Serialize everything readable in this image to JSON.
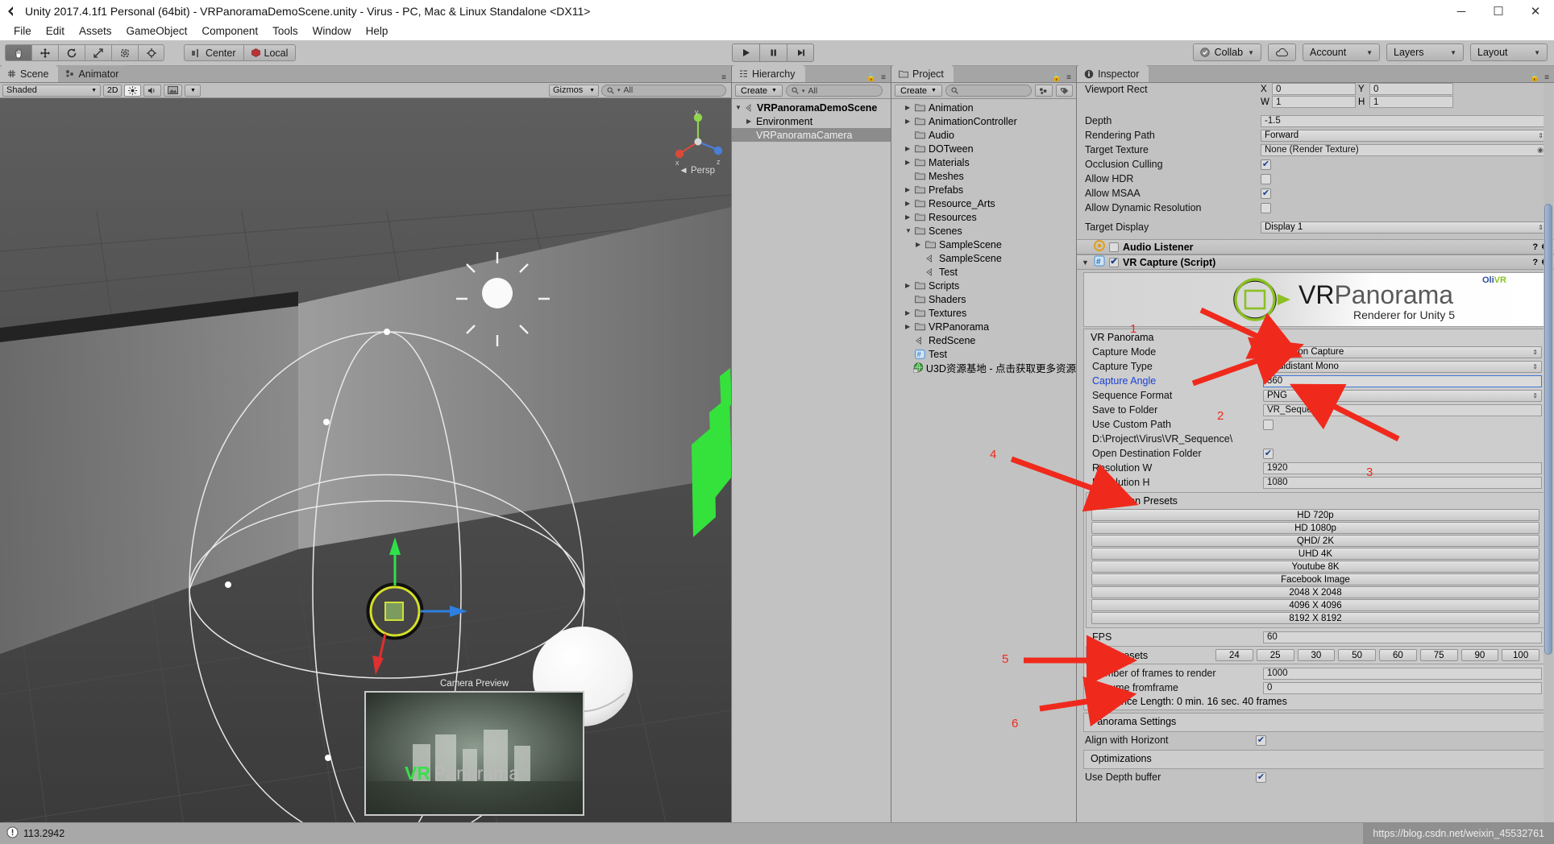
{
  "window": {
    "title": "Unity 2017.4.1f1 Personal (64bit) - VRPanoramaDemoScene.unity - Virus - PC, Mac & Linux Standalone <DX11>",
    "minimize": "─",
    "maximize": "☐",
    "close": "✕"
  },
  "menubar": {
    "items": [
      "File",
      "Edit",
      "Assets",
      "GameObject",
      "Component",
      "Tools",
      "Window",
      "Help"
    ]
  },
  "toolbar": {
    "transform_tools": [
      "hand-tool",
      "move-tool",
      "rotate-tool",
      "scale-tool",
      "rect-tool",
      "transform-tool"
    ],
    "pivot": "Center",
    "space": "Local",
    "play": "▶",
    "pause": "Ⅱ",
    "step": "▶|",
    "collab": "Collab",
    "account": "Account",
    "layers": "Layers",
    "layout": "Layout"
  },
  "scene": {
    "tabs": [
      {
        "label": "Scene",
        "active": true
      },
      {
        "label": "Animator",
        "active": false
      }
    ],
    "draw_mode": "Shaded",
    "mode_2d": "2D",
    "search_placeholder": "All",
    "gizmos": "Gizmos",
    "perspective_label": "Persp",
    "axis_labels": {
      "x": "x",
      "y": "y",
      "z": "z"
    },
    "camera_preview_label": "Camera Preview",
    "preview_text_green": "VR",
    "preview_text_grey": "Panorama"
  },
  "hierarchy": {
    "tab": "Hierarchy",
    "create": "Create",
    "search_placeholder": "All",
    "items": [
      {
        "label": "VRPanoramaDemoScene",
        "depth": 0,
        "arrow": "▼",
        "bold": true,
        "selected": false,
        "icon": "scene-icon"
      },
      {
        "label": "Environment",
        "depth": 1,
        "arrow": "▶",
        "bold": false,
        "selected": false,
        "icon": "none"
      },
      {
        "label": "VRPanoramaCamera",
        "depth": 1,
        "arrow": "",
        "bold": false,
        "selected": true,
        "icon": "none"
      }
    ]
  },
  "project": {
    "tab": "Project",
    "create": "Create",
    "search_placeholder": "",
    "items": [
      {
        "label": "Animation",
        "depth": 1,
        "arrow": "▶",
        "icon": "folder"
      },
      {
        "label": "AnimationController",
        "depth": 1,
        "arrow": "▶",
        "icon": "folder"
      },
      {
        "label": "Audio",
        "depth": 1,
        "arrow": "",
        "icon": "folder"
      },
      {
        "label": "DOTween",
        "depth": 1,
        "arrow": "▶",
        "icon": "folder"
      },
      {
        "label": "Materials",
        "depth": 1,
        "arrow": "▶",
        "icon": "folder"
      },
      {
        "label": "Meshes",
        "depth": 1,
        "arrow": "",
        "icon": "folder"
      },
      {
        "label": "Prefabs",
        "depth": 1,
        "arrow": "▶",
        "icon": "folder"
      },
      {
        "label": "Resource_Arts",
        "depth": 1,
        "arrow": "▶",
        "icon": "folder"
      },
      {
        "label": "Resources",
        "depth": 1,
        "arrow": "▶",
        "icon": "folder"
      },
      {
        "label": "Scenes",
        "depth": 1,
        "arrow": "▼",
        "icon": "folder"
      },
      {
        "label": "SampleScene",
        "depth": 2,
        "arrow": "▶",
        "icon": "folder"
      },
      {
        "label": "SampleScene",
        "depth": 2,
        "arrow": "",
        "icon": "scene"
      },
      {
        "label": "Test",
        "depth": 2,
        "arrow": "",
        "icon": "scene"
      },
      {
        "label": "Scripts",
        "depth": 1,
        "arrow": "▶",
        "icon": "folder"
      },
      {
        "label": "Shaders",
        "depth": 1,
        "arrow": "",
        "icon": "folder"
      },
      {
        "label": "Textures",
        "depth": 1,
        "arrow": "▶",
        "icon": "folder"
      },
      {
        "label": "VRPanorama",
        "depth": 1,
        "arrow": "▶",
        "icon": "folder"
      },
      {
        "label": "RedScene",
        "depth": 1,
        "arrow": "",
        "icon": "scene"
      },
      {
        "label": "Test",
        "depth": 1,
        "arrow": "",
        "icon": "script"
      },
      {
        "label": "U3D资源基地 - 点击获取更多资源",
        "depth": 1,
        "arrow": "",
        "icon": "web"
      }
    ]
  },
  "inspector": {
    "tab": "Inspector",
    "camera": {
      "viewport_rect_label": "Viewport Rect",
      "viewport": {
        "x_key": "X",
        "x": "0",
        "y_key": "Y",
        "y": "0",
        "w_key": "W",
        "w": "1",
        "h_key": "H",
        "h": "1"
      },
      "depth_label": "Depth",
      "depth": "-1.5",
      "rendering_path_label": "Rendering Path",
      "rendering_path": "Forward",
      "target_texture_label": "Target Texture",
      "target_texture": "None (Render Texture)",
      "occlusion_culling_label": "Occlusion Culling",
      "occlusion_culling": true,
      "allow_hdr_label": "Allow HDR",
      "allow_hdr": false,
      "allow_msaa_label": "Allow MSAA",
      "allow_msaa": true,
      "allow_dynamic_resolution_label": "Allow Dynamic Resolution",
      "allow_dynamic_resolution": false,
      "target_display_label": "Target Display",
      "target_display": "Display 1"
    },
    "audio_listener": {
      "title": "Audio Listener",
      "enabled": false
    },
    "vr_capture": {
      "title": "VR Capture (Script)",
      "enabled": true,
      "logo_main": "VRPanorama",
      "logo_sub": "Renderer for Unity 5",
      "logo_badge": "OliVR",
      "section_title": "VR Panorama",
      "capture_mode_label": "Capture Mode",
      "capture_mode": "Animation Capture",
      "capture_type_label": "Capture Type",
      "capture_type": "Equidistant Mono",
      "capture_angle_label": "Capture Angle",
      "capture_angle": "360",
      "sequence_format_label": "Sequence Format",
      "sequence_format": "PNG",
      "save_to_folder_label": "Save to Folder",
      "save_to_folder": "VR_Sequence",
      "use_custom_path_label": "Use Custom Path",
      "use_custom_path": false,
      "full_path": "D:\\Project\\Virus\\VR_Sequence\\",
      "open_destination_folder_label": "Open Destination Folder",
      "open_destination_folder": true,
      "resolution_w_label": "Resolution W",
      "resolution_w": "1920",
      "resolution_h_label": "Resolution H",
      "resolution_h": "1080",
      "resolution_presets_title": "Resolution Presets",
      "resolution_presets": [
        "HD 720p",
        "HD 1080p",
        "QHD/ 2K",
        "UHD 4K",
        "Youtube 8K",
        "Facebook Image",
        "2048 X 2048",
        "4096 X 4096",
        "8192 X 8192"
      ],
      "fps_label": "FPS",
      "fps": "60",
      "fps_presets_label": "FPS Presets",
      "fps_presets": [
        "24",
        "25",
        "30",
        "50",
        "60",
        "75",
        "90",
        "100"
      ],
      "frames_to_render_label": "Number of frames to render",
      "frames_to_render": "1000",
      "resume_from_frame_label": "Resume fromframe",
      "resume_from_frame": "0",
      "sequence_length": "Sequence Length: 0 min. 16 sec. 40 frames",
      "panorama_settings_title": "Panorama Settings",
      "align_with_horizont_label": "Align with Horizont",
      "align_with_horizont": true,
      "optimizations_title": "Optimizations",
      "use_depth_buffer_label": "Use Depth buffer",
      "use_depth_buffer": true
    }
  },
  "annotations": {
    "color": "#ef2a1c",
    "numbers": [
      {
        "id": "1",
        "text": "1"
      },
      {
        "id": "2",
        "text": "2"
      },
      {
        "id": "3",
        "text": "3"
      },
      {
        "id": "4",
        "text": "4"
      },
      {
        "id": "5",
        "text": "5"
      },
      {
        "id": "6",
        "text": "6"
      }
    ]
  },
  "statusbar": {
    "message": "113.2942",
    "watermark": "https://blog.csdn.net/weixin_45532761"
  }
}
